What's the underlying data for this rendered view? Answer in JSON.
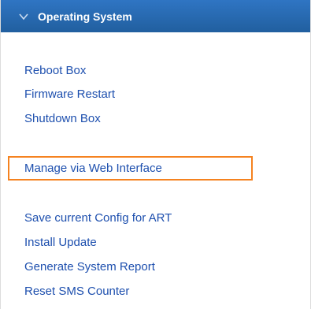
{
  "header": {
    "title": "Operating System",
    "icon": "chevron-down-icon"
  },
  "links": {
    "reboot_box": "Reboot Box",
    "firmware_restart": "Firmware Restart",
    "shutdown_box": "Shutdown Box",
    "manage_web": "Manage via Web Interface",
    "save_config": "Save current Config for ART",
    "install_update": "Install Update",
    "system_report": "Generate System Report",
    "reset_sms": "Reset SMS Counter"
  },
  "colors": {
    "header_bg": "#2a6bb3",
    "link": "#1d4fae",
    "highlight": "#f5821f"
  }
}
